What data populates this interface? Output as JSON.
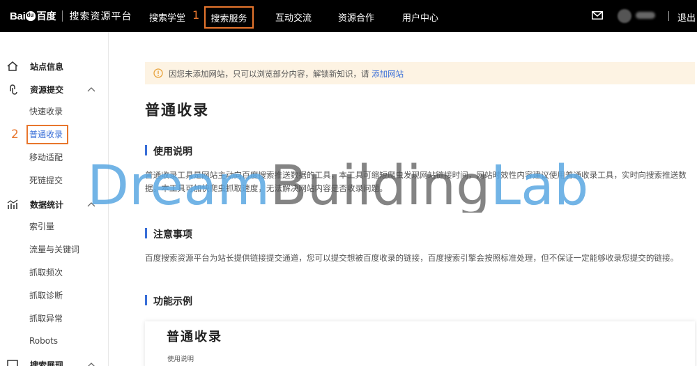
{
  "topbar": {
    "logo_bai": "Bai",
    "logo_cn": "百度",
    "platform": "搜索资源平台",
    "nav": [
      {
        "label": "搜索学堂"
      },
      {
        "label": "搜索服务"
      },
      {
        "label": "互动交流"
      },
      {
        "label": "资源合作"
      },
      {
        "label": "用户中心"
      }
    ],
    "step_marker": "1",
    "logout": "退出"
  },
  "sidebar": {
    "groups": [
      {
        "label": "站点信息",
        "icon": "home-icon"
      },
      {
        "label": "资源提交",
        "icon": "link-icon",
        "expanded": true,
        "items": [
          "快速收录",
          "普通收录",
          "移动适配",
          "死链提交"
        ]
      },
      {
        "label": "数据统计",
        "icon": "bar-chart-icon",
        "expanded": true,
        "items": [
          "索引量",
          "流量与关键词",
          "抓取频次",
          "抓取诊断",
          "抓取异常",
          "Robots"
        ]
      },
      {
        "label": "搜索展现",
        "icon": "display-icon"
      }
    ],
    "active_item": "普通收录",
    "step_marker": "2"
  },
  "main": {
    "notice_text": "因您未添加网站，只可以浏览部分内容，解锁新知识，请",
    "notice_link": "添加网站",
    "title": "普通收录",
    "usage_title": "使用说明",
    "usage_line1": "普通收录工具是网站主动向百度搜索推送数据的工具，本工具可缩短爬虫发现网站链接时间，网站时效性内容建议使用普通收录工具，实时向搜索推送数",
    "usage_line2": "据。本工具可加快爬虫抓取速度，无法解决网站内容是否收录问题。",
    "notes_title": "注意事项",
    "notes_text": "百度搜索资源平台为站长提供链接提交通道，您可以提交想被百度收录的链接，百度搜索引擎会按照标准处理，但不保证一定能够收录您提交的链接。",
    "example_section_title": "功能示例",
    "example_card_title": "普通收录",
    "example_card_sub": "使用说明"
  },
  "watermark": {
    "part1": "Dream",
    "part2": "Building",
    "part3": "Lab"
  },
  "colors": {
    "accent": "#e8762d",
    "link": "#3a6fd8",
    "watermark_blue": "#5aa7e2",
    "watermark_gray": "#666666"
  }
}
